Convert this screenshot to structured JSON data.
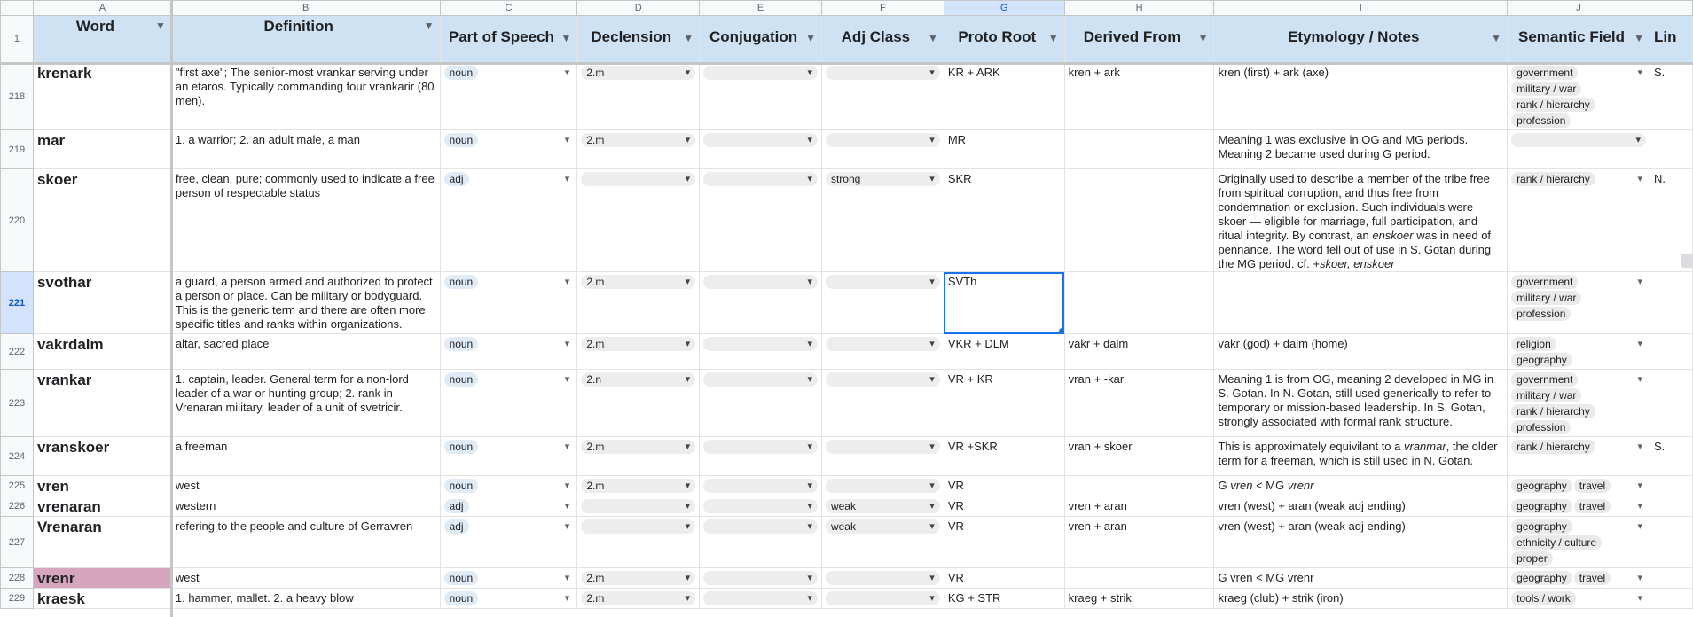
{
  "columns": [
    "A",
    "B",
    "C",
    "D",
    "E",
    "F",
    "G",
    "H",
    "I",
    "J",
    ""
  ],
  "header_row_number": "1",
  "headers": [
    "Word",
    "Definition",
    "Part of Speech",
    "Declension",
    "Conjugation",
    "Adj Class",
    "Proto Root",
    "Derived From",
    "Etymology / Notes",
    "Semantic Field",
    "Lin"
  ],
  "selected_cell": "G221",
  "rows": [
    {
      "num": "218",
      "word": "krenark",
      "definition": "\"first axe\"; The senior-most vrankar serving under an etaros. Typically commanding four vrankarir (80 men).",
      "pos": "noun",
      "declension": "2.m",
      "conjugation": "",
      "adj_class": "",
      "proto_root": "KR + ARK",
      "derived_from": "kren + ark",
      "etymology": "kren (first) + ark (axe)",
      "semantic": [
        "government",
        "military / war",
        "rank / hierarchy",
        "profession"
      ],
      "link": "S."
    },
    {
      "num": "219",
      "word": "mar",
      "definition": "1. a warrior; 2. an adult male, a man",
      "pos": "noun",
      "declension": "2.m",
      "conjugation": "",
      "adj_class": "",
      "proto_root": "MR",
      "derived_from": "",
      "etymology": "Meaning 1 was exclusive in OG and MG periods. Meaning 2 became used during G period.",
      "semantic": [],
      "link": ""
    },
    {
      "num": "220",
      "word": "skoer",
      "definition": "free, clean, pure; commonly used to indicate a free person of respectable status",
      "pos": "adj",
      "declension": "",
      "conjugation": "",
      "adj_class": "strong",
      "proto_root": "SKR",
      "derived_from": "",
      "etymology_parts": [
        "Originally used to describe a member of the tribe free from spiritual corruption, and thus free from condemnation or exclusion. Such individuals were skoer — eligible for marriage, full participation, and ritual integrity. By contrast, an ",
        {
          "i": "enskoer"
        },
        " was in need of pennance. The word fell out of use in S. Gotan during the MG period. cf. ",
        {
          "i": "+skoer, enskoer"
        }
      ],
      "semantic": [
        "rank / hierarchy"
      ],
      "link": "N."
    },
    {
      "num": "221",
      "word": "svothar",
      "definition": "a guard, a person armed and authorized to protect a person or place. Can be military or bodyguard. This is the generic term and there are often more specific titles and ranks within organizations.",
      "pos": "noun",
      "declension": "2.m",
      "conjugation": "",
      "adj_class": "",
      "proto_root": "SVTh",
      "derived_from": "",
      "etymology": "",
      "semantic": [
        "government",
        "military / war",
        "profession"
      ],
      "link": "",
      "selected": true
    },
    {
      "num": "222",
      "word": "vakrdalm",
      "definition": "altar, sacred place",
      "pos": "noun",
      "declension": "2.m",
      "conjugation": "",
      "adj_class": "",
      "proto_root": "VKR + DLM",
      "derived_from": "vakr + dalm",
      "etymology": "vakr (god) + dalm (home)",
      "semantic": [
        "religion",
        "geography"
      ],
      "link": ""
    },
    {
      "num": "223",
      "word": "vrankar",
      "definition": "1. captain, leader. General term for a non-lord leader of a war or hunting group; 2. rank in Vrenaran military, leader of a unit of svetricir.",
      "pos": "noun",
      "declension": "2.n",
      "conjugation": "",
      "adj_class": "",
      "proto_root": "VR + KR",
      "derived_from": "vran + -kar",
      "etymology": "Meaning 1 is from OG, meaning 2 developed in MG in S. Gotan. In N. Gotan, still used generically to refer to temporary or mission-based leadership. In S. Gotan, strongly associated with formal rank structure.",
      "semantic": [
        "government",
        "military / war",
        "rank / hierarchy",
        "profession"
      ],
      "link": ""
    },
    {
      "num": "224",
      "word": "vranskoer",
      "definition": "a freeman",
      "pos": "noun",
      "declension": "2.m",
      "conjugation": "",
      "adj_class": "",
      "proto_root": "VR +SKR",
      "derived_from": "vran + skoer",
      "etymology_parts": [
        "This is approximately equivilant to a ",
        {
          "i": "vranmar"
        },
        ", the older term for a freeman, which is still used in N. Gotan."
      ],
      "semantic": [
        "rank / hierarchy"
      ],
      "link": "S."
    },
    {
      "num": "225",
      "word": "vren",
      "definition": "west",
      "pos": "noun",
      "declension": "2.m",
      "conjugation": "",
      "adj_class": "",
      "proto_root": "VR",
      "derived_from": "",
      "etymology_parts": [
        "G ",
        {
          "i": "vren"
        },
        " < MG ",
        {
          "i": "vrenr"
        }
      ],
      "semantic": [
        "geography",
        "travel"
      ],
      "link": ""
    },
    {
      "num": "226",
      "word": "vrenaran",
      "definition": "western",
      "pos": "adj",
      "declension": "",
      "conjugation": "",
      "adj_class": "weak",
      "proto_root": "VR",
      "derived_from": "vren + aran",
      "etymology": "vren (west) + aran (weak adj ending)",
      "semantic": [
        "geography",
        "travel"
      ],
      "link": ""
    },
    {
      "num": "227",
      "word": "Vrenaran",
      "definition": "refering to the people and culture of Gerravren",
      "pos": "adj",
      "declension": "",
      "conjugation": "",
      "adj_class": "weak",
      "proto_root": "VR",
      "derived_from": "vren + aran",
      "etymology": "vren (west) + aran (weak adj ending)",
      "semantic": [
        "geography",
        "ethnicity / culture",
        "proper"
      ],
      "link": ""
    },
    {
      "num": "228",
      "word": "vrenr",
      "definition": "west",
      "pos": "noun",
      "declension": "2.m",
      "conjugation": "",
      "adj_class": "",
      "proto_root": "VR",
      "derived_from": "",
      "etymology": "G vren < MG vrenr",
      "semantic": [
        "geography",
        "travel"
      ],
      "link": "",
      "pink": true
    },
    {
      "num": "229",
      "word": "kraesk",
      "definition": "1. hammer, mallet. 2. a heavy blow",
      "pos": "noun",
      "declension": "2.m",
      "conjugation": "",
      "adj_class": "",
      "proto_root": "KG + STR",
      "derived_from": "kraeg + strik",
      "etymology": "kraeg (club) + strik (iron)",
      "semantic": [
        "tools / work"
      ],
      "link": ""
    }
  ]
}
